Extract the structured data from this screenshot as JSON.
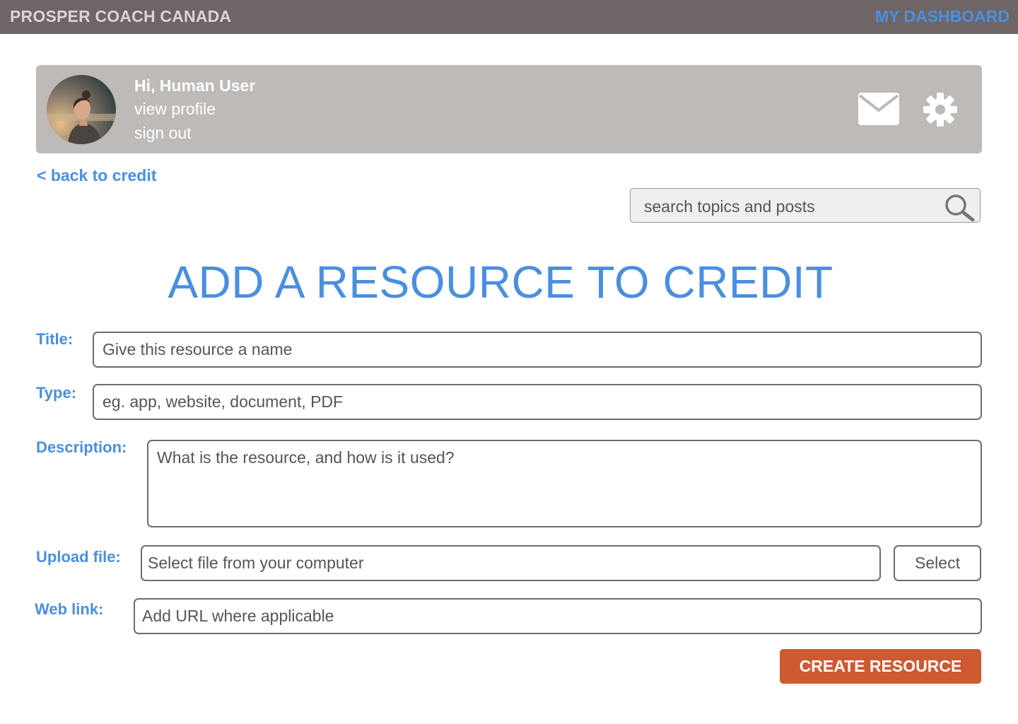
{
  "header": {
    "brand": "PROSPER COACH CANADA",
    "dashboard_link": "MY DASHBOARD"
  },
  "profile": {
    "greeting": "Hi, Human User",
    "view_profile": "view profile",
    "sign_out": "sign out",
    "avatar_icon": "user-photo",
    "mail_icon": "envelope-icon",
    "settings_icon": "gear-icon"
  },
  "nav": {
    "back_link": "< back to credit"
  },
  "search": {
    "placeholder": "search topics and posts",
    "icon": "magnifier-icon"
  },
  "page": {
    "title": "ADD A RESOURCE TO CREDIT"
  },
  "form": {
    "title": {
      "label": "Title:",
      "placeholder": "Give this resource a name"
    },
    "type": {
      "label": "Type:",
      "placeholder": "eg. app, website, document, PDF"
    },
    "description": {
      "label": "Description:",
      "placeholder": "What is the resource, and how is it used?"
    },
    "upload": {
      "label": "Upload file:",
      "placeholder": "Select file from your computer",
      "button": "Select"
    },
    "weblink": {
      "label": "Web link:",
      "placeholder": "Add URL where applicable"
    },
    "submit": "CREATE RESOURCE"
  },
  "colors": {
    "topbar": "#6e6666",
    "accent_blue": "#4a8fe0",
    "profile_card": "#bdbab7",
    "create_button": "#cd5a30"
  }
}
